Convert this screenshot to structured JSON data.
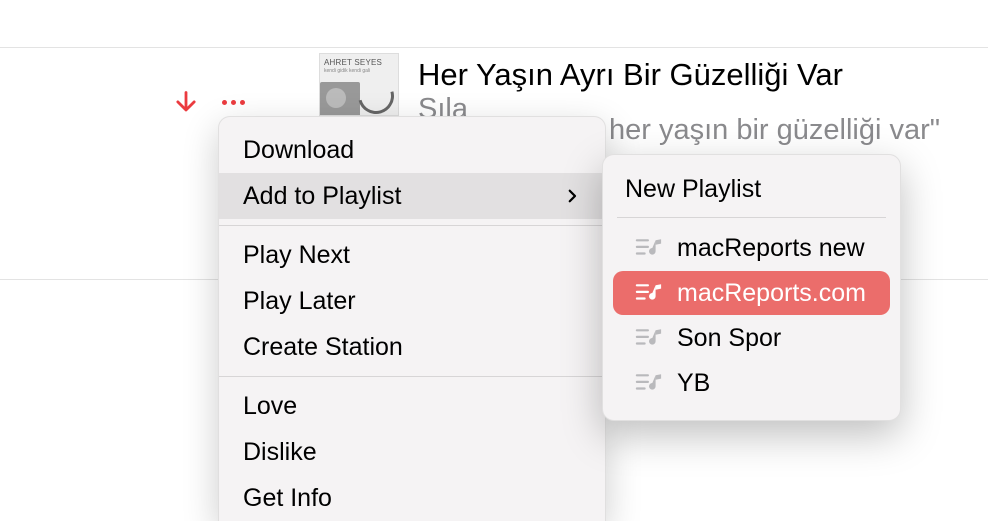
{
  "track": {
    "title": "Her Yaşın Ayrı Bir Güzelliği Var",
    "artist": "Sıla",
    "lyric_fragment": "her yaşın bir güzelliği var\"",
    "album_art_top_text": "AHRET SEYES",
    "album_art_sub_text": "kendi gidik kendi gali"
  },
  "context_menu": {
    "download": "Download",
    "add_to_playlist": "Add to Playlist",
    "play_next": "Play Next",
    "play_later": "Play Later",
    "create_station": "Create Station",
    "love": "Love",
    "dislike": "Dislike",
    "get_info": "Get Info"
  },
  "playlist_submenu": {
    "new_playlist": "New Playlist",
    "items": [
      {
        "name": "macReports new",
        "selected": false
      },
      {
        "name": "macReports.com",
        "selected": true
      },
      {
        "name": "Son Spor",
        "selected": false
      },
      {
        "name": "YB",
        "selected": false
      }
    ]
  },
  "colors": {
    "accent_red": "#eb3b3f",
    "highlight_red": "#eb6d6b",
    "muted_text": "#8a8a8d",
    "menu_bg": "#f5f3f4",
    "highlight_row": "#e2e0e1"
  }
}
